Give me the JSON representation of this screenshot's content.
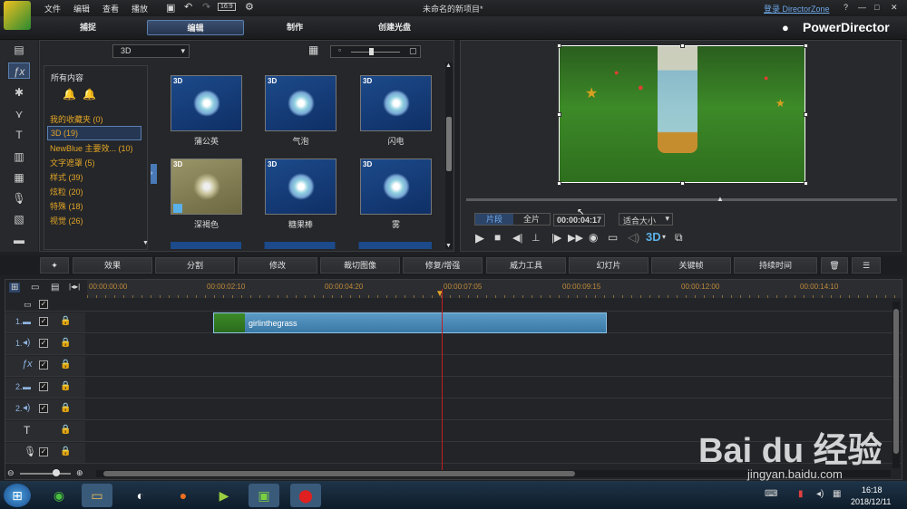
{
  "titlebar": {
    "menu": [
      "文件",
      "编辑",
      "查看",
      "播放"
    ],
    "timecode_badge": "16:9",
    "window_title": "未命名的新项目*",
    "login_link": "登录 DirectorZone",
    "window_controls": [
      "?",
      "—",
      "□",
      "✕"
    ]
  },
  "tabs": [
    "捕捉",
    "编辑",
    "制作",
    "创建光盘"
  ],
  "active_tab": "编辑",
  "brand": "PowerDirector",
  "library": {
    "dropdown": "3D",
    "category_header": "所有内容",
    "categories": [
      {
        "label": "我的收藏夹",
        "count": "(0)"
      },
      {
        "label": "3D",
        "count": "(19)"
      },
      {
        "label": "NewBlue 主要效...",
        "count": "(10)"
      },
      {
        "label": "文字遮罩",
        "count": "(5)"
      },
      {
        "label": "样式",
        "count": "(39)"
      },
      {
        "label": "炫粒",
        "count": "(20)"
      },
      {
        "label": "特殊",
        "count": "(18)"
      },
      {
        "label": "视觉",
        "count": "(26)"
      }
    ],
    "selected_category": "3D",
    "thumbnails": [
      {
        "tag": "3D",
        "label": "蒲公英"
      },
      {
        "tag": "3D",
        "label": "气泡"
      },
      {
        "tag": "3D",
        "label": "闪电"
      },
      {
        "tag": "3D",
        "label": "深褐色"
      },
      {
        "tag": "3D",
        "label": "糖果棒"
      },
      {
        "tag": "3D",
        "label": "雾"
      }
    ]
  },
  "preview": {
    "mode_clip": "片段",
    "mode_full": "全片",
    "timecode": "00:00:04:17",
    "fit": "适合大小",
    "threed": "3D"
  },
  "toolbar": [
    "效果",
    "分割",
    "修改",
    "裁切图像",
    "修复/增强",
    "威力工具",
    "幻灯片",
    "关键帧",
    "持续时间"
  ],
  "timeline": {
    "ruler": [
      "00:00:00:00",
      "00:00:02:10",
      "00:00:04:20",
      "00:00:07:05",
      "00:00:09:15",
      "00:00:12:00",
      "00:00:14:10"
    ],
    "tracks": [
      {
        "num": "1.",
        "icon": "video-track-icon"
      },
      {
        "num": "1.",
        "icon": "audio-track-icon"
      },
      {
        "num": "",
        "icon": "fx-track-icon"
      },
      {
        "num": "2.",
        "icon": "video-track-icon"
      },
      {
        "num": "2.",
        "icon": "audio-track-icon"
      },
      {
        "num": "",
        "icon": "title-track-icon"
      },
      {
        "num": "",
        "icon": "voice-track-icon"
      }
    ],
    "clip_name": "girlinthegrass"
  },
  "taskbar": {
    "time": "16:18",
    "date": "2018/12/11"
  },
  "watermark": {
    "brand": "Bai du 经验",
    "url": "jingyan.baidu.com"
  }
}
